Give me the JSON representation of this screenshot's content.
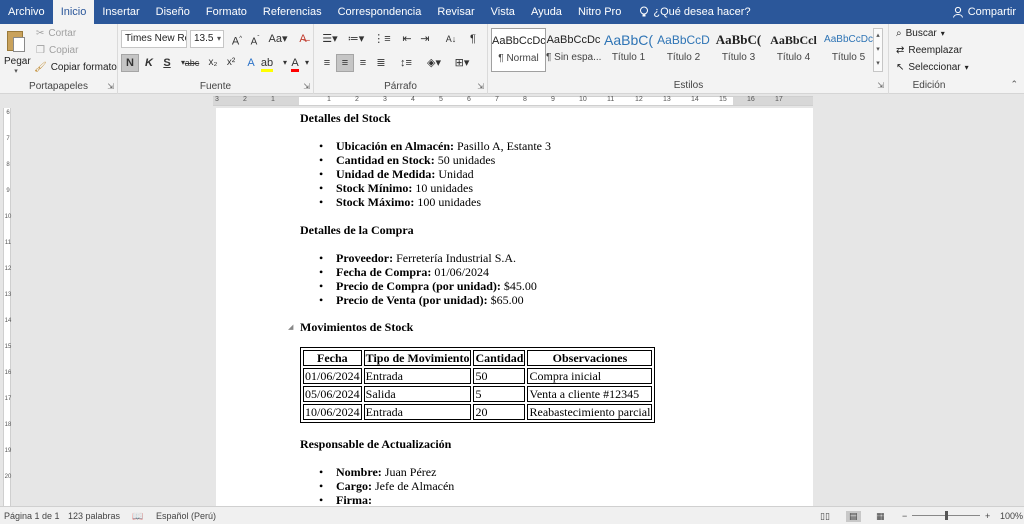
{
  "tabs": [
    "Archivo",
    "Inicio",
    "Insertar",
    "Diseño",
    "Formato",
    "Referencias",
    "Correspondencia",
    "Revisar",
    "Vista",
    "Ayuda",
    "Nitro Pro"
  ],
  "tell_me": "¿Qué desea hacer?",
  "share": "Compartir",
  "ribbon": {
    "clipboard": {
      "paste": "Pegar",
      "cut": "Cortar",
      "copy": "Copiar",
      "format_painter": "Copiar formato",
      "label": "Portapapeles"
    },
    "font": {
      "name": "Times New Ro",
      "size": "13.5",
      "label": "Fuente",
      "case": "Aa",
      "bold": "N",
      "italic": "K",
      "underline": "S",
      "strike": "abc",
      "subscript": "x₂",
      "superscript": "x²"
    },
    "paragraph": {
      "label": "Párrafo",
      "pilcrow": "¶"
    },
    "styles": {
      "label": "Estilos",
      "items": [
        {
          "sample": "AaBbCcDc",
          "name": "¶ Normal"
        },
        {
          "sample": "AaBbCcDc",
          "name": "¶ Sin espa..."
        },
        {
          "sample": "AaBbC(",
          "name": "Título 1"
        },
        {
          "sample": "AaBbCcD",
          "name": "Título 2"
        },
        {
          "sample": "AaBbC(",
          "name": "Título 3"
        },
        {
          "sample": "AaBbCcl",
          "name": "Título 4"
        },
        {
          "sample": "AaBbCcDc",
          "name": "Título 5"
        }
      ]
    },
    "editing": {
      "find": "Buscar",
      "replace": "Reemplazar",
      "select": "Seleccionar",
      "label": "Edición"
    }
  },
  "document": {
    "stock_heading": "Detalles del Stock",
    "stock_items": [
      {
        "label": "Ubicación en Almacén:",
        "value": " Pasillo A, Estante 3"
      },
      {
        "label": "Cantidad en Stock:",
        "value": " 50 unidades"
      },
      {
        "label": "Unidad de Medida:",
        "value": " Unidad"
      },
      {
        "label": "Stock Mínimo:",
        "value": " 10 unidades"
      },
      {
        "label": "Stock Máximo:",
        "value": " 100 unidades"
      }
    ],
    "purchase_heading": "Detalles de la Compra",
    "purchase_items": [
      {
        "label": "Proveedor:",
        "value": " Ferretería Industrial S.A."
      },
      {
        "label": "Fecha de Compra:",
        "value": " 01/06/2024"
      },
      {
        "label": "Precio de Compra (por unidad):",
        "value": " $45.00"
      },
      {
        "label": "Precio de Venta (por unidad):",
        "value": " $65.00"
      }
    ],
    "movements_heading": "Movimientos de Stock",
    "table": {
      "headers": [
        "Fecha",
        "Tipo de Movimiento",
        "Cantidad",
        "Observaciones"
      ],
      "rows": [
        [
          "01/06/2024",
          "Entrada",
          "50",
          "Compra inicial"
        ],
        [
          "05/06/2024",
          "Salida",
          "5",
          "Venta a cliente #12345"
        ],
        [
          "10/06/2024",
          "Entrada",
          "20",
          "Reabastecimiento parcial"
        ]
      ]
    },
    "responsible_heading": "Responsable de Actualización",
    "responsible_items": [
      {
        "label": "Nombre:",
        "value": " Juan Pérez"
      },
      {
        "label": "Cargo:",
        "value": " Jefe de Almacén"
      },
      {
        "label": "Firma:",
        "value": ""
      }
    ]
  },
  "status": {
    "page": "Página 1 de 1",
    "words": "123 palabras",
    "language": "Español (Perú)",
    "zoom": "100%"
  },
  "ruler_numbers": [
    "3",
    "2",
    "1",
    "1",
    "2",
    "3",
    "4",
    "5",
    "6",
    "7",
    "8",
    "9",
    "10",
    "11",
    "12",
    "13",
    "14",
    "15",
    "16",
    "17"
  ],
  "vruler_numbers": [
    "6",
    "7",
    "8",
    "9",
    "10",
    "11",
    "12",
    "13",
    "14",
    "15",
    "16",
    "17",
    "18",
    "19",
    "20"
  ],
  "colors": {
    "word_blue": "#2b579a",
    "ribbon_bg": "#f3f3f3",
    "canvas_bg": "#e6e6e6",
    "highlight_yellow": "#ffff00",
    "font_color_red": "#ff0000"
  }
}
